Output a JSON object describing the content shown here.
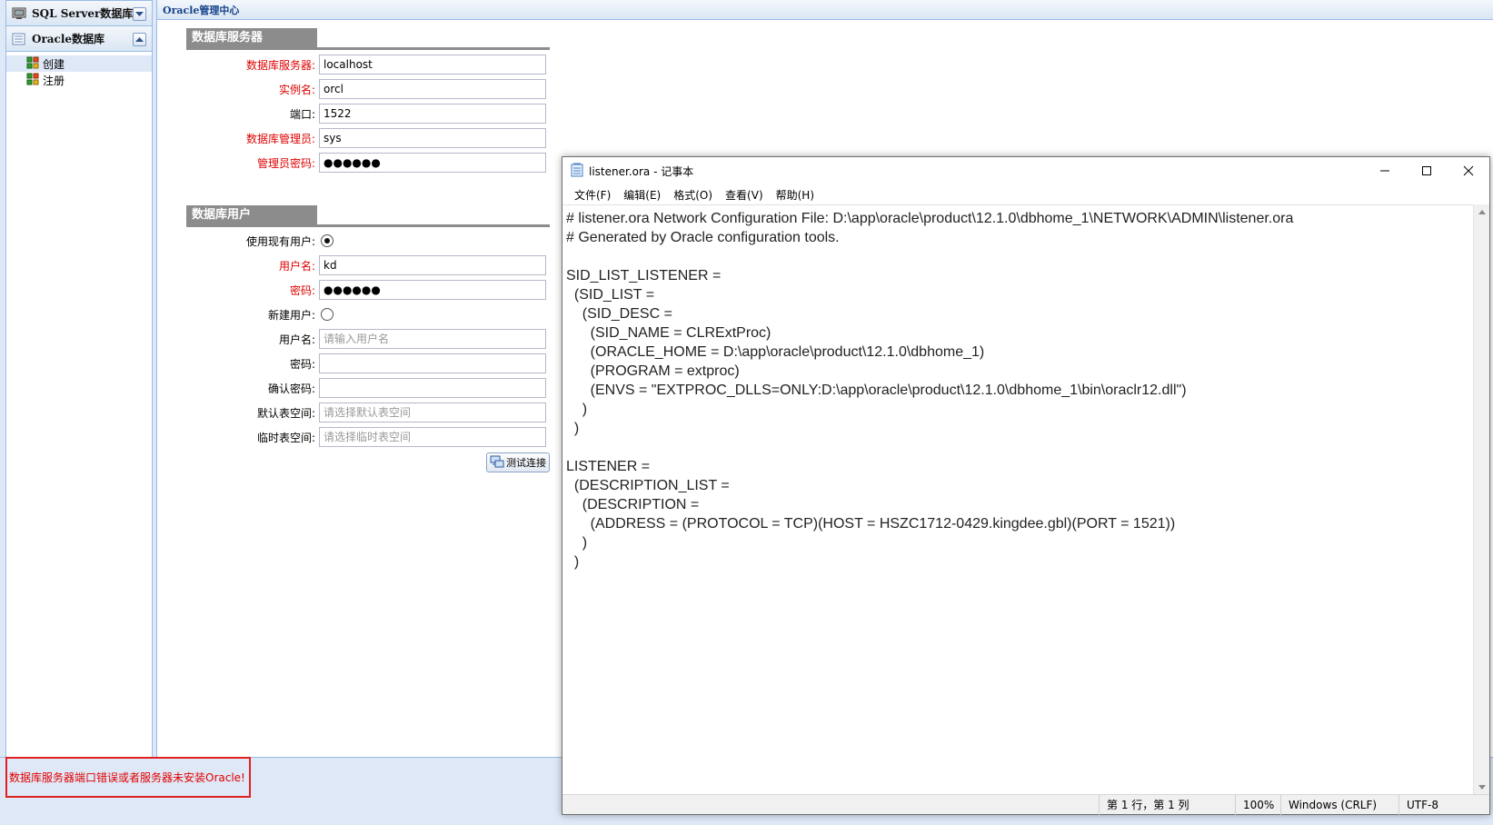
{
  "sidebar": {
    "sqlserver_label": "SQL Server数据库",
    "oracle_label": "Oracle数据库",
    "items": [
      {
        "label": "创建"
      },
      {
        "label": "注册"
      }
    ]
  },
  "main": {
    "title": "Oracle管理中心",
    "server_section": {
      "title": "数据库服务器",
      "fields": [
        {
          "label": "数据库服务器:",
          "value": "localhost"
        },
        {
          "label": "实例名:",
          "value": "orcl"
        },
        {
          "label": "端口:",
          "value": "1522"
        },
        {
          "label": "数据库管理员:",
          "value": "sys"
        },
        {
          "label": "管理员密码:",
          "value": "●●●●●●"
        }
      ]
    },
    "user_section": {
      "title": "数据库用户",
      "use_existing_label": "使用现有用户:",
      "username_label": "用户名:",
      "username_value": "kd",
      "password_label": "密码:",
      "password_value": "●●●●●●",
      "new_user_label": "新建用户:",
      "new_username_label": "用户名:",
      "new_username_placeholder": "请输入用户名",
      "new_password_label": "密码:",
      "confirm_password_label": "确认密码:",
      "default_tablespace_label": "默认表空间:",
      "default_tablespace_placeholder": "请选择默认表空间",
      "temp_tablespace_label": "临时表空间:",
      "temp_tablespace_placeholder": "请选择临时表空间"
    },
    "test_button_label": "测试连接"
  },
  "error_message": "数据库服务器端口错误或者服务器未安装Oracle!",
  "notepad": {
    "title": "listener.ora - 记事本",
    "menu": [
      "文件(F)",
      "编辑(E)",
      "格式(O)",
      "查看(V)",
      "帮助(H)"
    ],
    "lines": [
      "# listener.ora Network Configuration File: D:\\app\\oracle\\product\\12.1.0\\dbhome_1\\NETWORK\\ADMIN\\listener.ora",
      "# Generated by Oracle configuration tools.",
      "",
      "SID_LIST_LISTENER =",
      "  (SID_LIST =",
      "    (SID_DESC =",
      "      (SID_NAME = CLRExtProc)",
      "      (ORACLE_HOME = D:\\app\\oracle\\product\\12.1.0\\dbhome_1)",
      "      (PROGRAM = extproc)",
      "      (ENVS = \"EXTPROC_DLLS=ONLY:D:\\app\\oracle\\product\\12.1.0\\dbhome_1\\bin\\oraclr12.dll\")",
      "    )",
      "  )",
      "",
      "LISTENER =",
      "  (DESCRIPTION_LIST =",
      "    (DESCRIPTION =",
      "      (ADDRESS = (PROTOCOL = TCP)(HOST = HSZC1712-0429.kingdee.gbl)(PORT = 1521))",
      "    )",
      "  )"
    ],
    "status": {
      "position": "第 1 行，第 1 列",
      "zoom": "100%",
      "line_ending": "Windows (CRLF)",
      "encoding": "UTF-8"
    }
  }
}
